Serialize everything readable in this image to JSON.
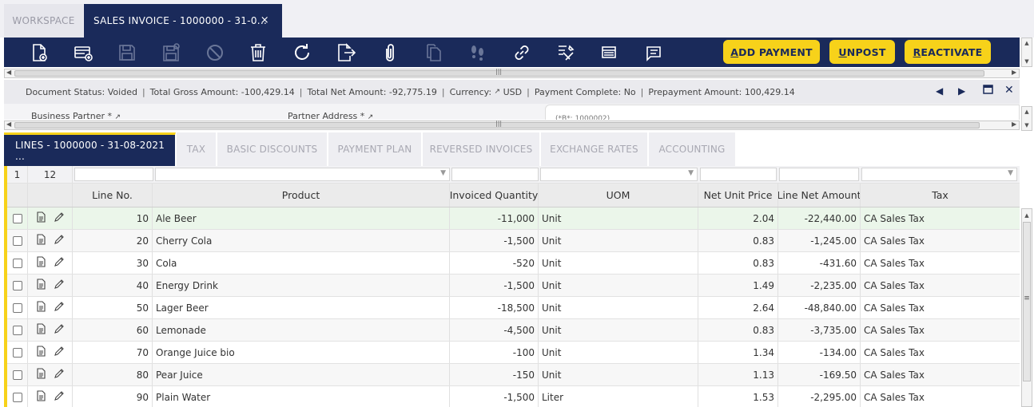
{
  "top_tabs": {
    "workspace": "WORKSPACE",
    "active": "SALES INVOICE - 1000000 - 31-0...",
    "close": "×"
  },
  "toolbar": {
    "icons": [
      "new-document-icon",
      "new-row-icon",
      "save-icon",
      "save-close-icon",
      "undo-icon",
      "delete-icon",
      "refresh-icon",
      "export-icon",
      "attachment-icon",
      "copy-record-icon",
      "audit-trail-icon",
      "link-icon",
      "tools-icon",
      "grid-view-icon",
      "notes-icon"
    ],
    "buttons": [
      {
        "mnemonic": "A",
        "rest": "DD PAYMENT"
      },
      {
        "mnemonic": "U",
        "rest": "NPOST"
      },
      {
        "mnemonic": "R",
        "rest": "EACTIVATE"
      }
    ]
  },
  "status": {
    "document_status_label": "Document Status:",
    "document_status": "Voided",
    "gross_label": "Total Gross Amount:",
    "gross": "-100,429.14",
    "net_label": "Total Net Amount:",
    "net": "-92,775.19",
    "currency_label": "Currency:",
    "currency": "USD",
    "payment_complete_label": "Payment Complete:",
    "payment_complete": "No",
    "prepayment_label": "Prepayment Amount:",
    "prepayment": "100,429.14",
    "separator": "|",
    "link_glyph": "↗"
  },
  "form": {
    "business_partner_label": "Business Partner *",
    "partner_address_label": "Partner Address *",
    "field_value": "(*B*: 1000002)"
  },
  "sub_tabs": [
    "LINES - 1000000 - 31-08-2021 ...",
    "TAX",
    "BASIC DISCOUNTS",
    "PAYMENT PLAN",
    "REVERSED INVOICES",
    "EXCHANGE RATES",
    "ACCOUNTING"
  ],
  "grid": {
    "selected_count": "1",
    "total_count": "12",
    "columns": [
      "Line No.",
      "Product",
      "Invoiced Quantity",
      "UOM",
      "Net Unit Price",
      "Line Net Amount",
      "Tax"
    ],
    "rows": [
      {
        "line": "10",
        "product": "Ale Beer",
        "qty": "-11,000",
        "uom": "Unit",
        "price": "2.04",
        "amount": "-22,440.00",
        "tax": "CA Sales Tax"
      },
      {
        "line": "20",
        "product": "Cherry Cola",
        "qty": "-1,500",
        "uom": "Unit",
        "price": "0.83",
        "amount": "-1,245.00",
        "tax": "CA Sales Tax"
      },
      {
        "line": "30",
        "product": "Cola",
        "qty": "-520",
        "uom": "Unit",
        "price": "0.83",
        "amount": "-431.60",
        "tax": "CA Sales Tax"
      },
      {
        "line": "40",
        "product": "Energy Drink",
        "qty": "-1,500",
        "uom": "Unit",
        "price": "1.49",
        "amount": "-2,235.00",
        "tax": "CA Sales Tax"
      },
      {
        "line": "50",
        "product": "Lager Beer",
        "qty": "-18,500",
        "uom": "Unit",
        "price": "2.64",
        "amount": "-48,840.00",
        "tax": "CA Sales Tax"
      },
      {
        "line": "60",
        "product": "Lemonade",
        "qty": "-4,500",
        "uom": "Unit",
        "price": "0.83",
        "amount": "-3,735.00",
        "tax": "CA Sales Tax"
      },
      {
        "line": "70",
        "product": "Orange Juice bio",
        "qty": "-100",
        "uom": "Unit",
        "price": "1.34",
        "amount": "-134.00",
        "tax": "CA Sales Tax"
      },
      {
        "line": "80",
        "product": "Pear Juice",
        "qty": "-150",
        "uom": "Unit",
        "price": "1.13",
        "amount": "-169.50",
        "tax": "CA Sales Tax"
      },
      {
        "line": "90",
        "product": "Plain Water",
        "qty": "-1,500",
        "uom": "Liter",
        "price": "1.53",
        "amount": "-2,295.00",
        "tax": "CA Sales Tax"
      }
    ]
  },
  "colors": {
    "navy": "#1a2a5a",
    "accent_yellow": "#f7d21a",
    "selected_row": "#ebf6ea"
  }
}
